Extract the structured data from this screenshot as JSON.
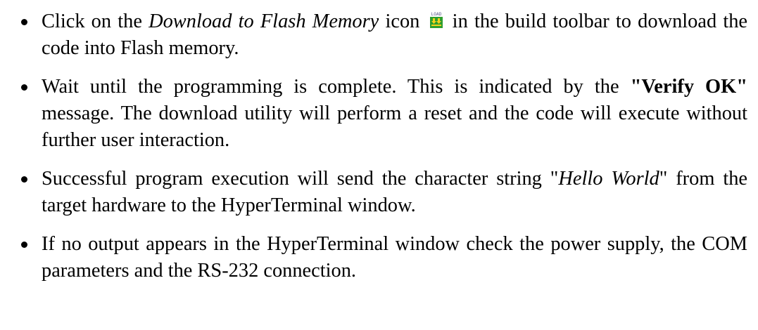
{
  "bullets": [
    {
      "parts": {
        "a": "Click on the ",
        "b": "Download to Flash Memory",
        "c": " icon ",
        "d": " in the build toolbar to download the code into Flash memory."
      },
      "icon": {
        "name": "load-flash-icon",
        "label": "LOAD"
      }
    },
    {
      "parts": {
        "a": "Wait until the programming is complete. This is indicated by the ",
        "b": "\"Verify OK\"",
        "c": " message. The download utility will perform a reset and the code will execute without further user interaction."
      }
    },
    {
      "parts": {
        "a": "Successful program execution will send the character string \"",
        "b": "Hello World",
        "c": "\" from the target hardware to the HyperTerminal window."
      }
    },
    {
      "parts": {
        "a": "If no output appears in the HyperTerminal window check the power supply, the COM parameters and the RS-232 connection."
      }
    }
  ],
  "colors": {
    "text": "#000000",
    "icon_green": "#2e9e2e",
    "icon_yellow": "#f2d21c",
    "icon_label": "#5a5a8a"
  }
}
